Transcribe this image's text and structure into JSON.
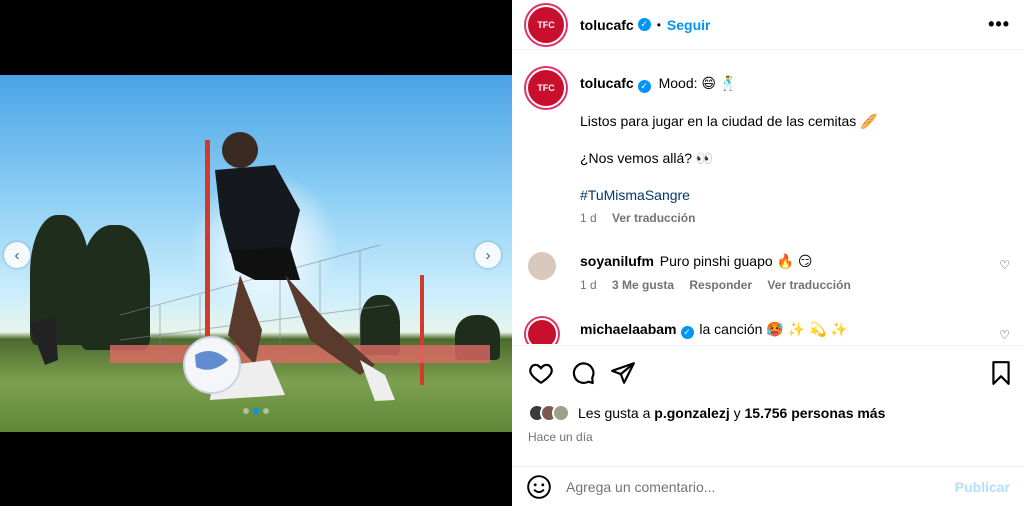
{
  "post": {
    "username": "tolucafc",
    "follow_label": "Seguir",
    "more_label": "•••",
    "avatar_text": "TFC"
  },
  "caption": {
    "username": "tolucafc",
    "line1": "Mood: 😄 🕺",
    "line2": "Listos para jugar en la ciudad de las cemitas 🥖",
    "line3": "¿Nos vemos allá? 👀",
    "hashtag": "#TuMismaSangre",
    "age": "1 d",
    "translate": "Ver traducción"
  },
  "comments": [
    {
      "username": "soyanilufm",
      "text": "Puro pinshi guapo 🔥 😏",
      "age": "1 d",
      "likes": "3 Me gusta",
      "reply": "Responder",
      "translate": "Ver traducción",
      "verified": false
    },
    {
      "username": "michaelaabam",
      "text": "la canción 🥵 ✨ 💫 ✨",
      "verified": true
    }
  ],
  "likes": {
    "prefix": "Les gusta a",
    "user": "p.gonzalezj",
    "middle": "y",
    "count": "15.756 personas más"
  },
  "timestamp": "Hace un día",
  "composer": {
    "placeholder": "Agrega un comentario...",
    "publish": "Publicar"
  },
  "carousel": {
    "slides": 3,
    "active_index": 1
  },
  "colors": {
    "accent": "#0095f6",
    "brand": "#c8102e"
  }
}
